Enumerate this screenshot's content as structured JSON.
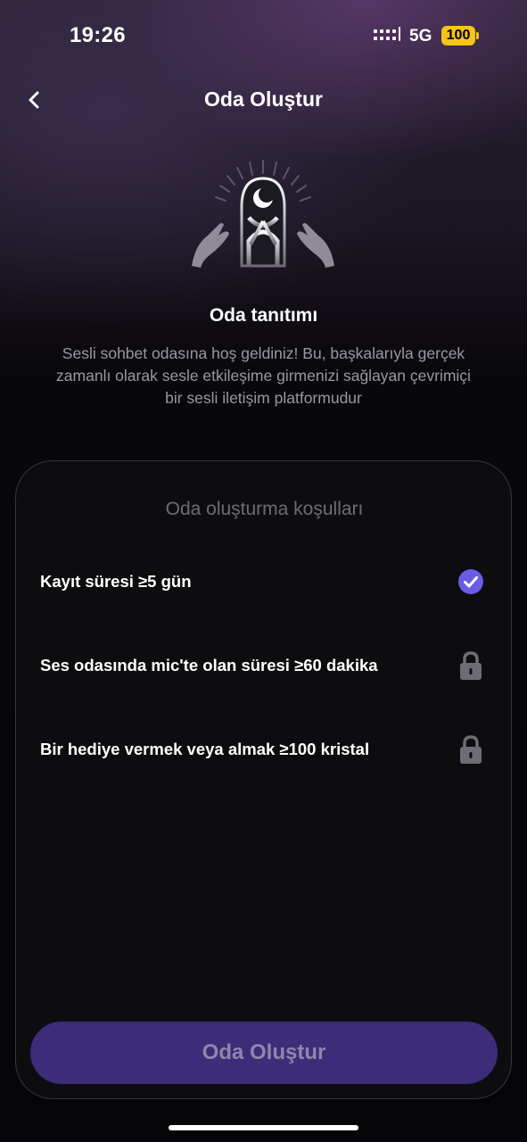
{
  "status_bar": {
    "time": "19:26",
    "network": "5G",
    "battery": "100",
    "battery_color": "#f5c518",
    "signal_icon": "signal-bars-icon"
  },
  "header": {
    "back_icon": "chevron-left-icon",
    "title": "Oda Oluştur"
  },
  "hero": {
    "illustration": "mystic-arch-hands-illustration"
  },
  "intro": {
    "title": "Oda tanıtımı",
    "description": "Sesli sohbet odasına hoş geldiniz! Bu, başkalarıyla gerçek zamanlı olarak sesle etkileşime girmenizi sağlayan çevrimiçi bir sesli iletişim platformudur"
  },
  "conditions": {
    "title": "Oda oluşturma koşulları",
    "items": [
      {
        "label": "Kayıt süresi ≥5 gün",
        "status": "met",
        "icon": "check-circle-icon"
      },
      {
        "label": "Ses odasında mic'te olan süresi ≥60 dakika",
        "status": "locked",
        "icon": "lock-icon"
      },
      {
        "label": "Bir hediye vermek veya almak ≥100 kristal",
        "status": "locked",
        "icon": "lock-icon"
      }
    ]
  },
  "action": {
    "create_label": "Oda Oluştur",
    "button_color": "#3d2c7a",
    "accent_color": "#6b5ce7"
  }
}
